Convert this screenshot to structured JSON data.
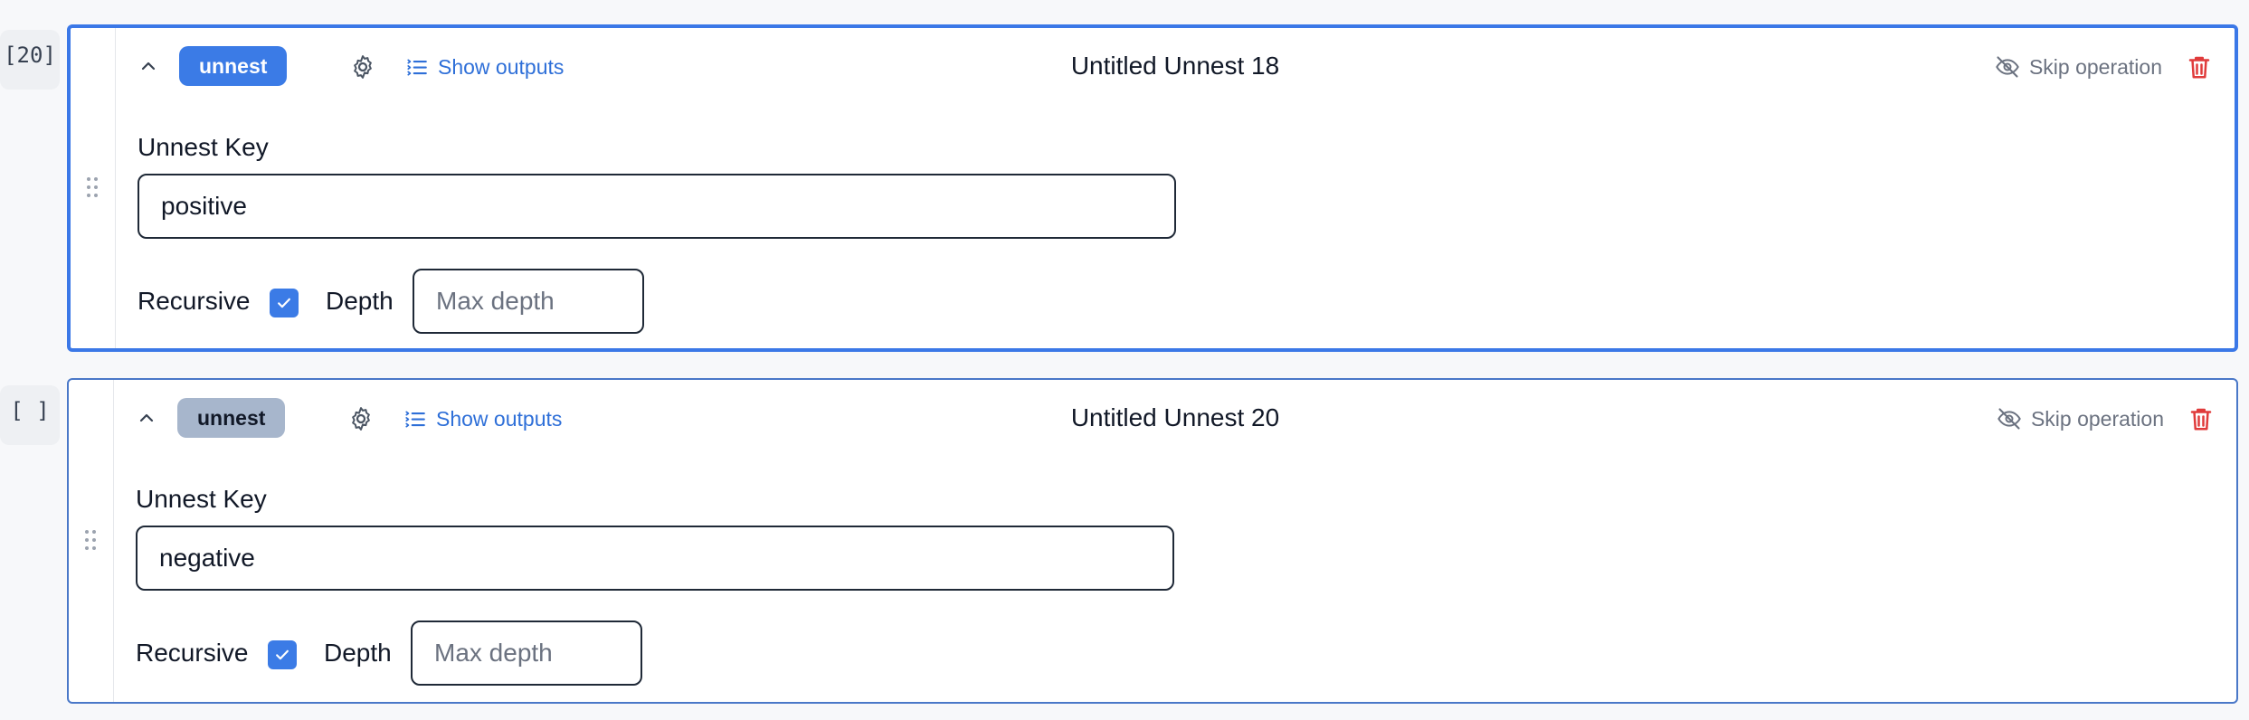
{
  "colors": {
    "accent": "#3b7be6",
    "link": "#2e6fd8",
    "danger": "#e03b3b",
    "muted": "#6b7280",
    "badge_inactive": "#a7b6cc"
  },
  "cells": [
    {
      "exec_count": "[20]",
      "badge": "unnest",
      "show_outputs": "Show outputs",
      "title": "Untitled Unnest 18",
      "skip_label": "Skip operation",
      "key_label": "Unnest Key",
      "key_value": "positive",
      "recursive_label": "Recursive",
      "recursive_checked": true,
      "depth_label": "Depth",
      "depth_placeholder": "Max depth"
    },
    {
      "exec_count": "[ ]",
      "badge": "unnest",
      "show_outputs": "Show outputs",
      "title": "Untitled Unnest 20",
      "skip_label": "Skip operation",
      "key_label": "Unnest Key",
      "key_value": "negative",
      "recursive_label": "Recursive",
      "recursive_checked": true,
      "depth_label": "Depth",
      "depth_placeholder": "Max depth"
    }
  ]
}
